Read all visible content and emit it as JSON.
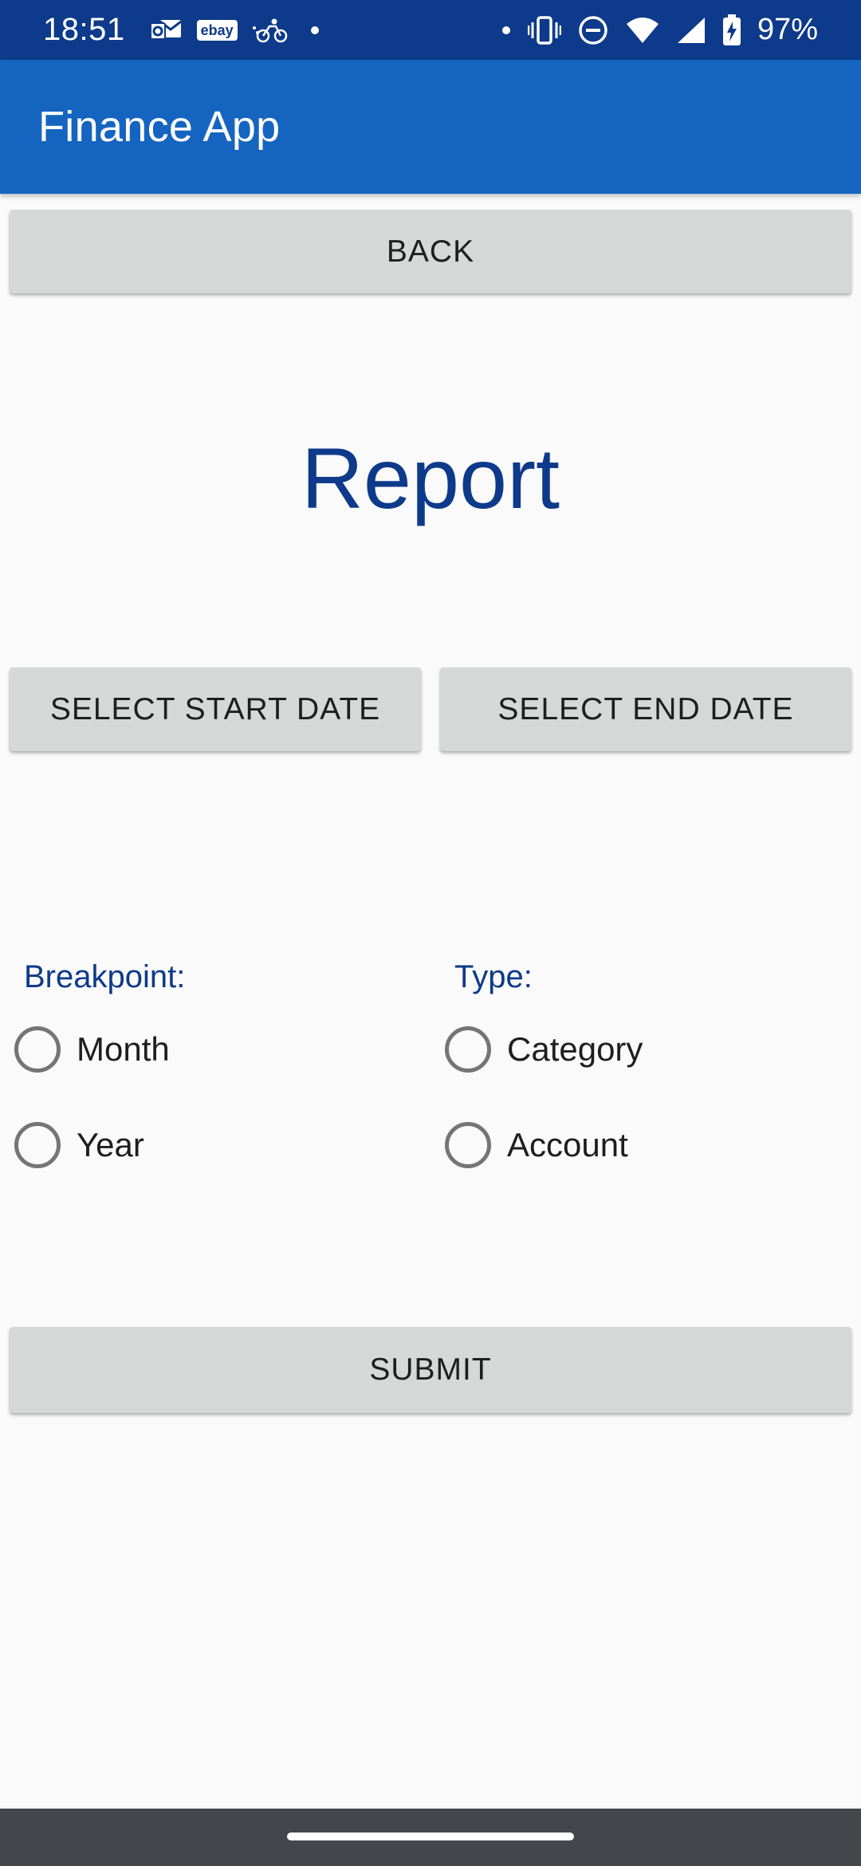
{
  "status_bar": {
    "time": "18:51",
    "left_icons": [
      "outlook-icon",
      "ebay-icon",
      "delivery-icon",
      "dot-icon"
    ],
    "ebay_label": "ebay",
    "battery_percent": "97%"
  },
  "app_bar": {
    "title": "Finance App"
  },
  "buttons": {
    "back": "BACK",
    "start_date": "SELECT START DATE",
    "end_date": "SELECT END DATE",
    "submit": "SUBMIT"
  },
  "report": {
    "title": "Report"
  },
  "breakpoint": {
    "label": "Breakpoint:",
    "options": [
      "Month",
      "Year"
    ]
  },
  "type": {
    "label": "Type:",
    "options": [
      "Category",
      "Account"
    ]
  },
  "colors": {
    "status_bar": "#0d3a8a",
    "app_bar": "#1565c0",
    "accent_text": "#0d3a8a",
    "button_bg": "#d6d7d7",
    "nav_bar": "#43474c"
  }
}
